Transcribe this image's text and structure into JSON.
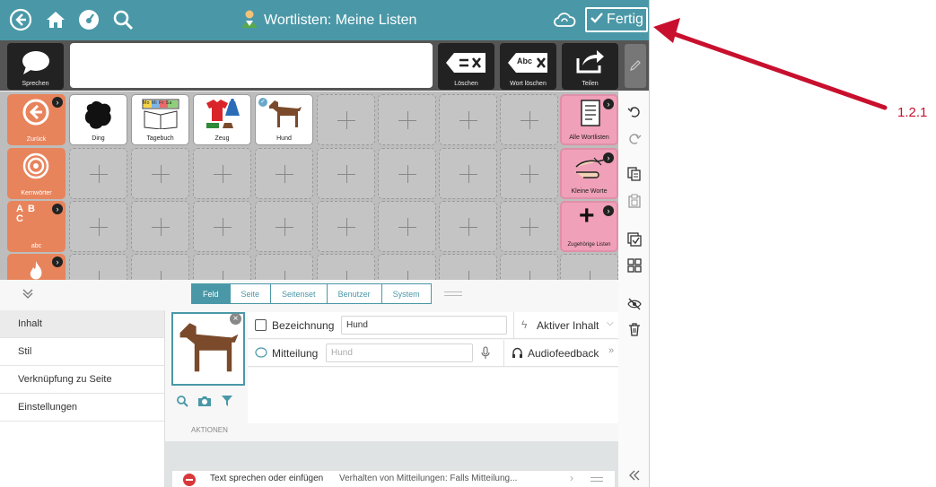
{
  "topbar": {
    "title": "Wortlisten: Meine Listen",
    "done_label": "Fertig",
    "icons": [
      "back-icon",
      "home-icon",
      "dashboard-icon",
      "search-icon",
      "user-icon",
      "cloud-sync-icon",
      "check-icon"
    ]
  },
  "message_bar": {
    "speak_label": "Sprechen",
    "clear_label": "Löschen",
    "delete_word_label": "Wort löschen",
    "delete_word_icon_text": "Abc",
    "share_label": "Teilen"
  },
  "grid": {
    "nav_buttons": [
      {
        "label": "Zurück"
      },
      {
        "label": "Kernwörter"
      },
      {
        "label": "abc",
        "icon_text": "ABC"
      }
    ],
    "words": [
      {
        "label": "Ding"
      },
      {
        "label": "Tagebuch",
        "icon_text": "Mo Mi Fr Sa"
      },
      {
        "label": "Zeug"
      },
      {
        "label": "Hund"
      }
    ],
    "right_buttons": [
      {
        "label": "Alle Wortlisten"
      },
      {
        "label": "Kleine Worte"
      },
      {
        "label": "Zugehörige Listen"
      }
    ]
  },
  "right_tools": [
    "undo-icon",
    "redo-icon",
    "copy-icon",
    "paste-icon",
    "select-all-icon",
    "select-cells-icon",
    "hide-icon",
    "trash-icon",
    "collapse-left-icon"
  ],
  "bottom": {
    "tabs": [
      {
        "label": "Feld",
        "active": true
      },
      {
        "label": "Seite",
        "active": false
      },
      {
        "label": "Seitenset",
        "active": false
      },
      {
        "label": "Benutzer",
        "active": false
      },
      {
        "label": "System",
        "active": false
      }
    ],
    "side_menu": [
      {
        "label": "Inhalt",
        "active": true
      },
      {
        "label": "Stil",
        "active": false
      },
      {
        "label": "Verknüpfung zu Seite",
        "active": false
      },
      {
        "label": "Einstellungen",
        "active": false
      }
    ],
    "fields": {
      "label_caption": "Bezeichnung",
      "label_value": "Hund",
      "active_content": "Aktiver Inhalt",
      "message_caption": "Mitteilung",
      "message_placeholder": "Hund",
      "audio_feedback": "Audiofeedback"
    },
    "actions_header": "AKTIONEN",
    "action_row": {
      "title": "Text sprechen oder einfügen",
      "detail": "Verhalten von Mitteilungen: Falls Mitteilung..."
    }
  },
  "annotation": {
    "label": "1.2.1",
    "color": "#c8102e"
  },
  "colors": {
    "accent": "#4a98a7",
    "nav_orange": "#e8845c",
    "pink": "#f0a0b8"
  }
}
